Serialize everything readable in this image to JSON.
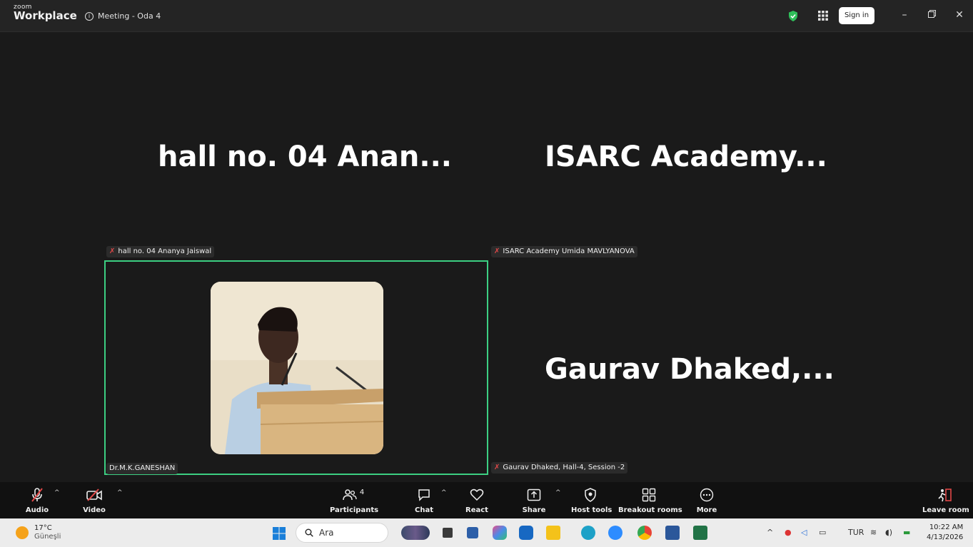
{
  "app": {
    "brand_top": "zoom",
    "brand_bottom": "Workplace",
    "meeting_title": "Meeting - Oda 4",
    "sign_in": "Sign in"
  },
  "stage": {
    "tiles": [
      {
        "big_name": "hall no. 04 Anan...",
        "tag": "hall no. 04 Ananya Jaiswal",
        "muted": true
      },
      {
        "big_name": "ISARC  Academy...",
        "tag": "ISARC Academy Umida MAVLYANOVA",
        "muted": true
      },
      {
        "tag": "Dr.M.K.GANESHAN",
        "muted": false,
        "active_speaker": true
      },
      {
        "big_name": "Gaurav  Dhaked,...",
        "tag": "Gaurav Dhaked, Hall-4, Session -2",
        "muted": true
      }
    ]
  },
  "toolbar": {
    "audio": "Audio",
    "video": "Video",
    "participants": "Participants",
    "participants_count": "4",
    "chat": "Chat",
    "react": "React",
    "share": "Share",
    "host_tools": "Host tools",
    "breakout": "Breakout rooms",
    "more": "More",
    "leave": "Leave room"
  },
  "taskbar": {
    "temp": "17°C",
    "weather": "Güneşli",
    "search_placeholder": "Ara",
    "lang": "TUR",
    "time": "10:22 AM",
    "date": "4/13/2026"
  },
  "colors": {
    "active_border": "#3ccf82",
    "muted_mic": "#e04848",
    "background": "#1a1a1a"
  }
}
